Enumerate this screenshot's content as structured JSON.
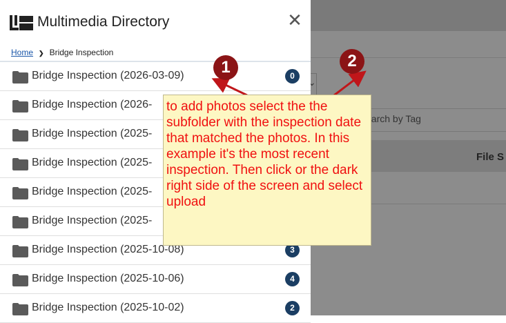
{
  "background": {
    "search_placeholder": "earch by Tag",
    "column_file_size": "File S"
  },
  "panel": {
    "title": "Multimedia Directory",
    "breadcrumb": {
      "home": "Home",
      "separator": "❯",
      "current": "Bridge Inspection"
    },
    "items": [
      {
        "label": "Bridge Inspection (2026-03-09)",
        "count": "0"
      },
      {
        "label": "Bridge Inspection (2026-",
        "count": ""
      },
      {
        "label": "Bridge Inspection (2025-",
        "count": ""
      },
      {
        "label": "Bridge Inspection (2025-",
        "count": ""
      },
      {
        "label": "Bridge Inspection (2025-",
        "count": ""
      },
      {
        "label": "Bridge Inspection (2025-",
        "count": ""
      },
      {
        "label": "Bridge Inspection (2025-10-08)",
        "count": "3"
      },
      {
        "label": "Bridge Inspection (2025-10-06)",
        "count": "4"
      },
      {
        "label": "Bridge Inspection (2025-10-02)",
        "count": "2"
      }
    ]
  },
  "annotation": {
    "step1": "1",
    "step2": "2",
    "callout": "to add photos select the the subfolder with the inspection date that matched the photos. In this example it's the most recent inspection. Then click or the dark right side of the screen and select upload"
  },
  "colors": {
    "badge": "#1b3e63",
    "step_marker": "#8b1416",
    "callout_bg": "#fdf7c3",
    "callout_text": "#f01010",
    "overlay": "#8c8c8c"
  }
}
